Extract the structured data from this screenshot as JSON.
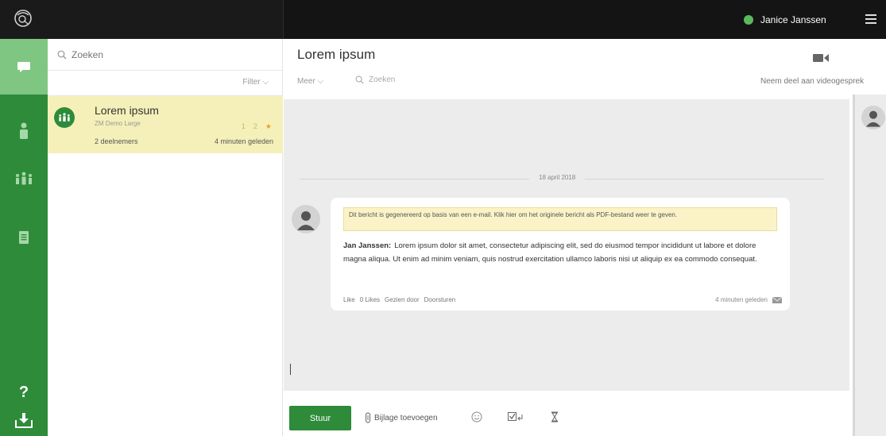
{
  "user": {
    "name": "Janice Janssen",
    "status_color": "#5cb85c"
  },
  "colors": {
    "brand_green": "#2e8b3a",
    "active_green": "#7fc682",
    "highlight_yellow": "#f5f0b9"
  },
  "sidebar": {
    "items": [
      {
        "icon": "chat-icon"
      },
      {
        "icon": "person-icon"
      },
      {
        "icon": "group-icon"
      },
      {
        "icon": "document-icon"
      }
    ],
    "help_label": "?",
    "download_icon": "download-icon"
  },
  "list": {
    "search_placeholder": "Zoeken",
    "filter_label": "Filter",
    "conversations": [
      {
        "title": "Lorem ipsum",
        "subtitle": "ZM Demo Large",
        "participants": "2 deelnemers",
        "time": "4 minuten geleden",
        "count1": "1",
        "count2": "2"
      }
    ]
  },
  "chat": {
    "title": "Lorem ipsum",
    "more_label": "Meer",
    "search_placeholder": "Zoeken",
    "video_join_label": "Neem deel aan videogesprek",
    "date_label": "18 april 2018",
    "message": {
      "note": "Dit bericht is gegenereerd op basis van een e-mail. Klik hier om het originele bericht als PDF-bestand weer te geven.",
      "author": "Jan Janssen:",
      "text": "Lorem ipsum dolor sit amet, consectetur adipiscing elit, sed do eiusmod tempor incididunt ut labore et dolore magna aliqua. Ut enim ad minim veniam, quis nostrud exercitation ullamco laboris nisi ut aliquip ex ea commodo consequat.",
      "actions": [
        "Like",
        "0 Likes",
        "Gezien door",
        "Doorsturen"
      ],
      "time": "4 minuten geleden"
    }
  },
  "composer": {
    "send_label": "Stuur",
    "attach_label": "Bijlage toevoegen"
  }
}
